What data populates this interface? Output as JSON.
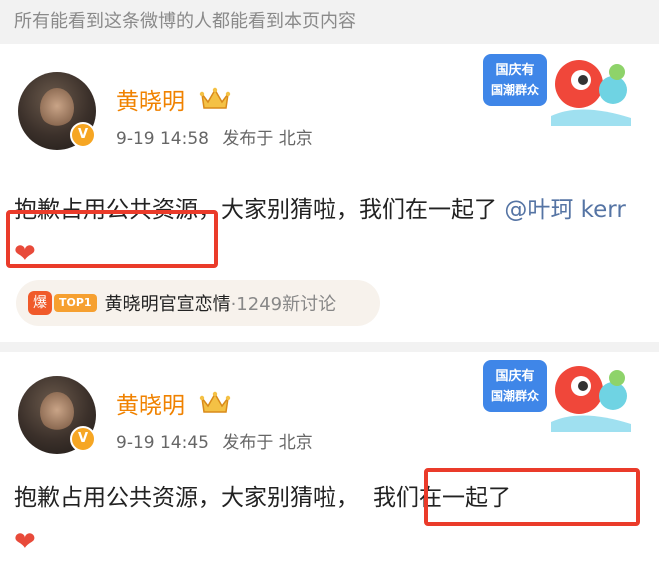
{
  "notice": "所有能看到这条微博的人都能看到本页内容",
  "badge": {
    "text_line1": "国庆有",
    "text_line2": "国潮群众"
  },
  "posts": [
    {
      "author": "黄晓明",
      "verified_mark": "V",
      "time": "9-19 14:58",
      "source": "发布于 北京",
      "text": "抱歉占用公共资源，大家别猜啦，我们在一起了",
      "mention": "@叶珂 kerr",
      "emoji": "❤",
      "topic": {
        "hot_icon": "爆",
        "rank_badge": "TOP1",
        "title": "黄晓明官宣恋情",
        "count": "·1249新讨论"
      }
    },
    {
      "author": "黄晓明",
      "verified_mark": "V",
      "time": "9-19 14:45",
      "source": "发布于 北京",
      "text_part1": "抱歉占用公共资源，大家别猜啦，",
      "text_part2": "我们在一起了",
      "emoji": "❤"
    }
  ],
  "colors": {
    "accent_name": "#f08200",
    "mention": "#5574a4",
    "highlight_box": "#ea3b2a"
  }
}
